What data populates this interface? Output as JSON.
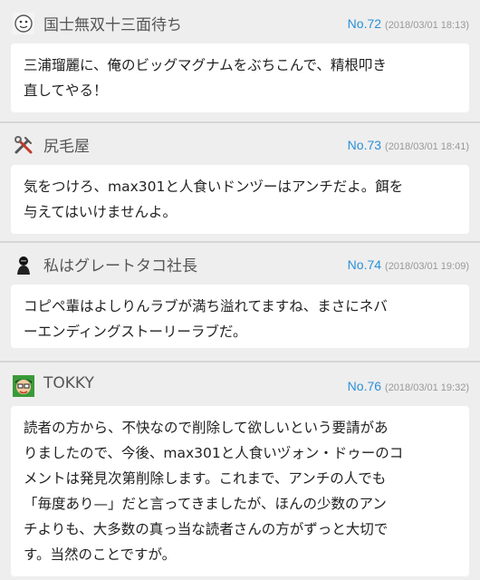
{
  "comments": [
    {
      "name": "国士無双十三面待ち",
      "number": "No.72",
      "timestamp": "(2018/03/01 18:13)",
      "avatar_icon": "cartoon-face-avatar-icon",
      "lines": [
        "三浦瑠麗に、俺のビッグマグナムをぶちこんで、精根叩き",
        "直してやる！"
      ]
    },
    {
      "name": "尻毛屋",
      "number": "No.73",
      "timestamp": "(2018/03/01 18:41)",
      "avatar_icon": "crossed-tools-avatar-icon",
      "lines": [
        "気をつけろ、max301と人食いドンヅーはアンチだよ。餌を",
        "与えてはいけませんよ。"
      ]
    },
    {
      "name": "私はグレートタコ社長",
      "number": "No.74",
      "timestamp": "(2018/03/01 19:09)",
      "avatar_icon": "dark-figure-avatar-icon",
      "lines": [
        "コピペ輩はよしりんラブが満ち溢れてますね、まさにネバ",
        "ーエンディングストーリーラブだ。"
      ]
    },
    {
      "name": "TOKKY",
      "number": "No.76",
      "timestamp": "(2018/03/01 19:32)",
      "avatar_icon": "cartoon-character-avatar-icon",
      "lines": [
        "読者の方から、不快なので削除して欲しいという要請があ",
        "りましたので、今後、max301と人食いヅォン・ドゥーのコ",
        "メントは発見次第削除します。これまで、アンチの人でも",
        "「毎度あり—」だと言ってきましたが、ほんの少数のアン",
        "チよりも、大多数の真っ当な読者さんの方がずっと大切で",
        "す。当然のことですが。"
      ]
    }
  ]
}
